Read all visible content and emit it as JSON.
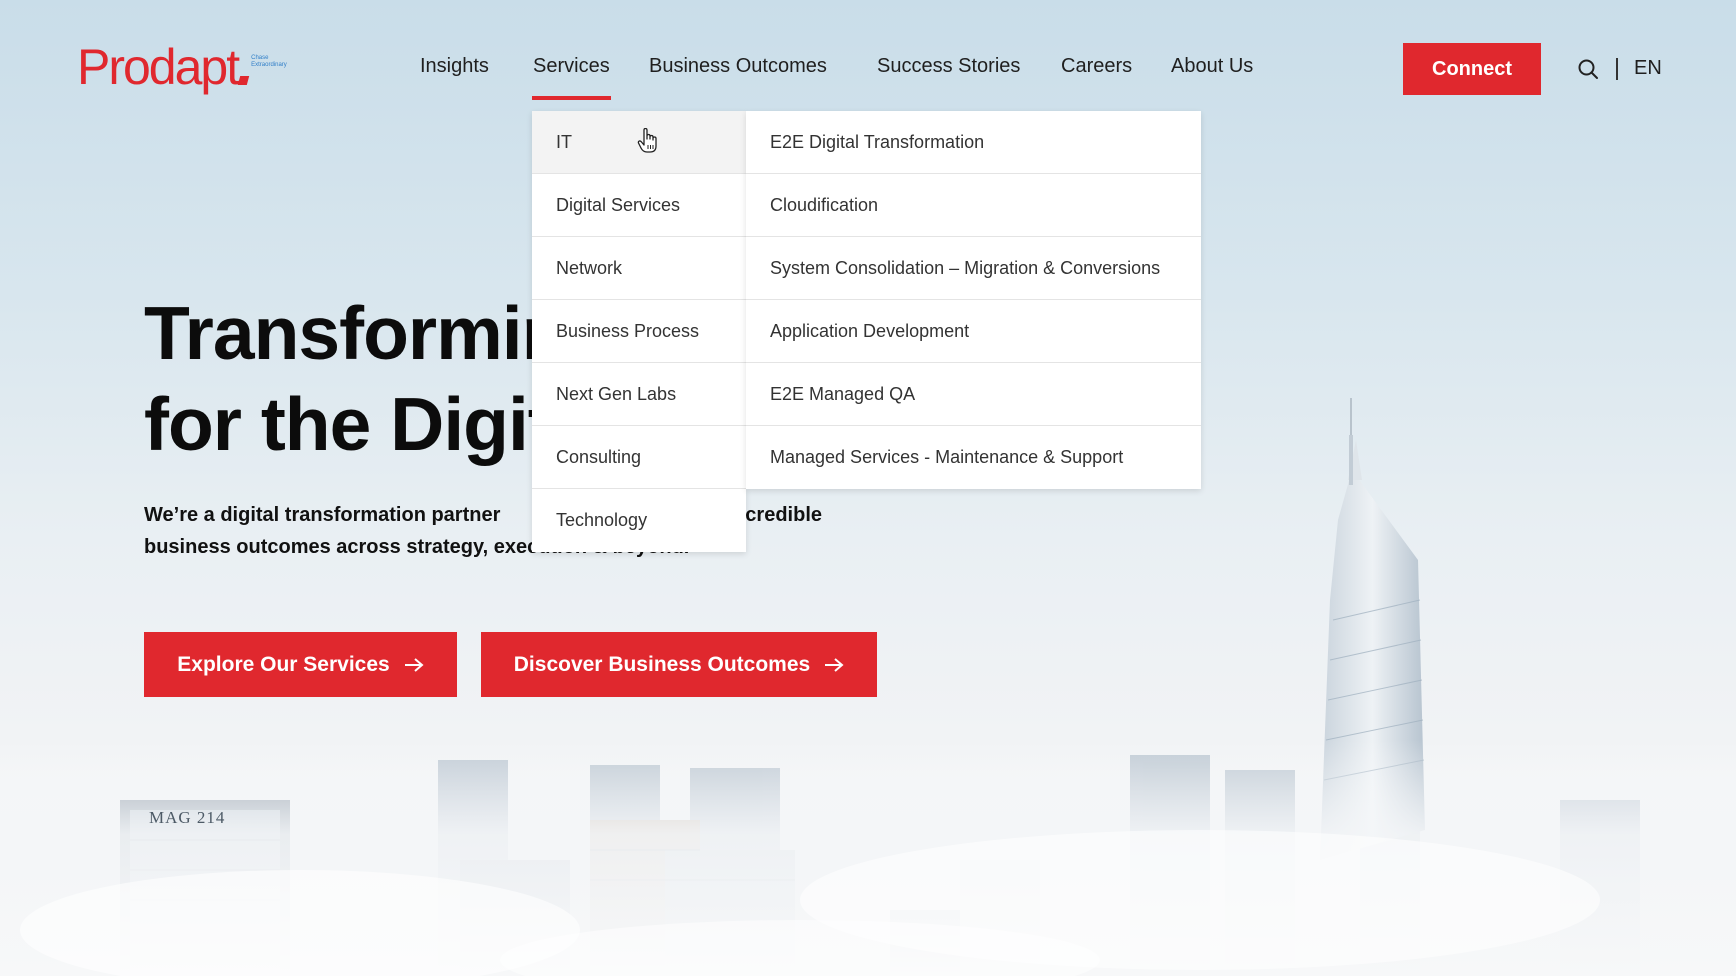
{
  "brand": {
    "name": "Prodapt",
    "tagline": "Chase Extraordinary",
    "accent": "#e0282e",
    "tagline_color": "#2f7ec8"
  },
  "nav": {
    "items": [
      "Insights",
      "Services",
      "Business Outcomes",
      "Success Stories",
      "Careers",
      "About Us"
    ],
    "active": "Services",
    "connect_label": "Connect",
    "search_icon": "search-icon",
    "language": "EN"
  },
  "hero": {
    "title_line1": "Transformir",
    "title_line2": "for the Digit",
    "subtitle_line1_start": "We’re a digital transformation partner",
    "subtitle_line1_end": "credible",
    "subtitle_line2": "business outcomes across strategy, execution & beyond.",
    "cta_primary": "Explore Our Services",
    "cta_secondary": "Discover Business Outcomes",
    "cta_icon": "arrow-right-icon"
  },
  "services_menu": {
    "categories": [
      "IT",
      "Digital Services",
      "Network",
      "Business Process",
      "Next Gen Labs",
      "Consulting",
      "Technology"
    ],
    "active_category": "IT",
    "it_services": [
      "E2E Digital Transformation",
      "Cloudification",
      "System Consolidation – Migration & Conversions",
      "Application Development",
      "E2E Managed QA",
      "Managed Services - Maintenance & Support"
    ]
  },
  "background": {
    "building_sign": "MAG 214"
  }
}
